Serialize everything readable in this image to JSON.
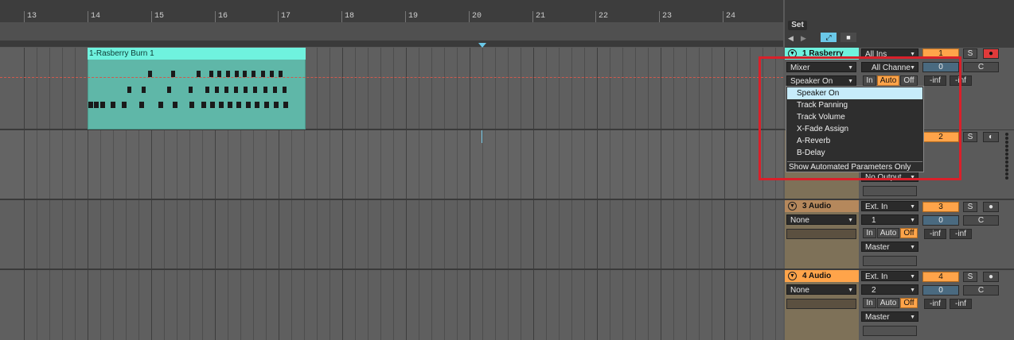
{
  "ruler": {
    "bars": [
      "13",
      "14",
      "15",
      "16",
      "17",
      "18",
      "19",
      "20",
      "21",
      "22",
      "23",
      "24"
    ]
  },
  "set": {
    "label": "Set",
    "back_icon": "arrow-left-icon",
    "fwd_icon": "arrow-right-icon",
    "follow_icon": "follow-icon",
    "lock_icon": "lock-icon"
  },
  "clip": {
    "title": "1-Rasberry Burn 1",
    "color": "#6ff2de"
  },
  "tracks": [
    {
      "title": "1 Rasberry",
      "color": "#6ff2de",
      "input_type": "All Ins",
      "input_channel": "All Channe",
      "device_chooser": "Mixer",
      "param_chooser": "Speaker On",
      "monitor": [
        "In",
        "Auto",
        "Off"
      ],
      "monitor_active": "Auto",
      "number": "1",
      "solo": "S",
      "vol": "0",
      "pan": "C",
      "meter1": "-inf",
      "meter2": "-inf"
    },
    {
      "number": "2",
      "solo": "S",
      "output": "No Output"
    },
    {
      "title": "3 Audio",
      "color": "#b5885c",
      "input_type": "Ext. In",
      "input_channel": "1",
      "device_chooser": "None",
      "monitor": [
        "In",
        "Auto",
        "Off"
      ],
      "monitor_active": "Off",
      "number": "3",
      "solo": "S",
      "vol": "0",
      "pan": "C",
      "meter1": "-inf",
      "meter2": "-inf",
      "output": "Master"
    },
    {
      "title": "4 Audio",
      "color": "#ffa44a",
      "input_type": "Ext. In",
      "input_channel": "2",
      "device_chooser": "None",
      "monitor": [
        "In",
        "Auto",
        "Off"
      ],
      "monitor_active": "Off",
      "number": "4",
      "solo": "S",
      "vol": "0",
      "pan": "C",
      "meter1": "-inf",
      "meter2": "-inf",
      "output": "Master"
    }
  ],
  "menu": {
    "items": [
      "Speaker On",
      "Track Panning",
      "Track Volume",
      "X-Fade Assign",
      "A-Reverb",
      "B-Delay"
    ],
    "selected": "Speaker On",
    "footer": "Show Automated Parameters Only"
  }
}
